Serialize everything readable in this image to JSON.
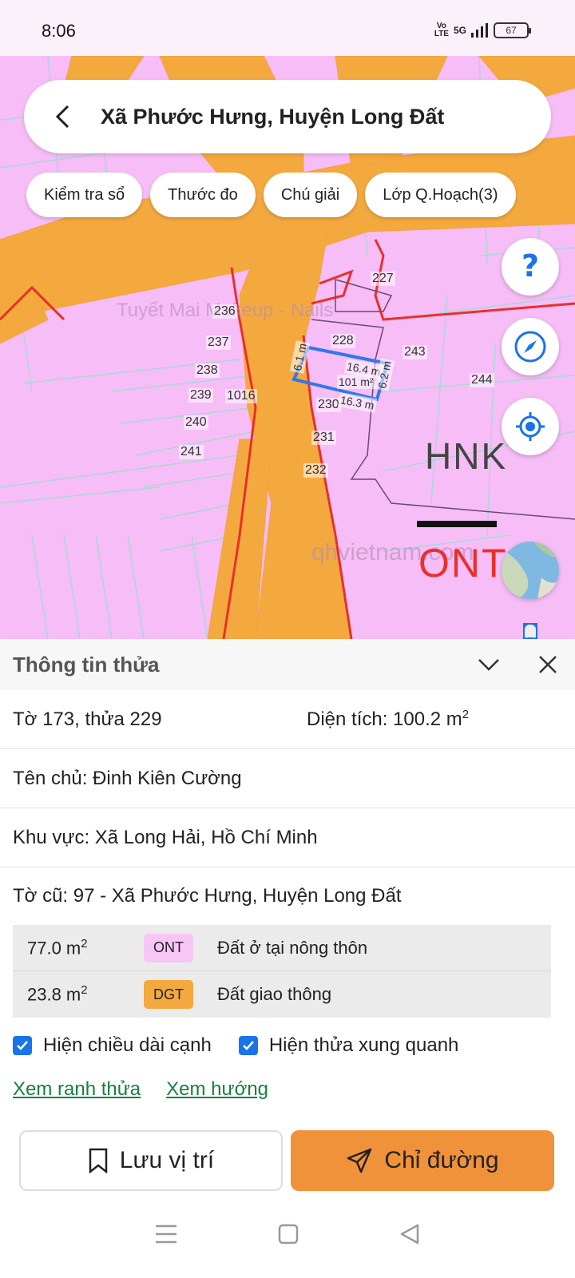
{
  "status_bar": {
    "time": "8:06",
    "network_top": "Vo",
    "network_bottom": "LTE",
    "network_type": "5G",
    "battery": "67"
  },
  "search": {
    "title": "Xã Phước Hưng, Huyện Long Đất"
  },
  "chips": [
    "Kiểm tra sổ",
    "Thước đo",
    "Chú giải",
    "Lớp Q.Hoạch(3)"
  ],
  "map": {
    "parcels": [
      "227",
      "228",
      "236",
      "237",
      "238",
      "239",
      "240",
      "241",
      "243",
      "244",
      "230",
      "231",
      "232",
      "1016"
    ],
    "measurements": {
      "top": "16.4 m",
      "area": "101 m²",
      "bottom": "16.3 m",
      "left": "6.1 m",
      "right": "6.2 m"
    },
    "zone_labels": [
      "HNK",
      "ONT"
    ],
    "watermark": "Tuyết Mai Makeup - Nails",
    "watermark2": "qhvietnam.com",
    "colors": {
      "residential": "#f7bdf7",
      "road": "#f4a93f",
      "boundary": "#e8302a",
      "selection": "#2f79e8"
    }
  },
  "sheet": {
    "title": "Thông tin thửa",
    "parcel": "Tờ 173, thửa 229",
    "area_label": "Diện tích: 100.2 m",
    "area_sup": "2",
    "owner": "Tên chủ: Đinh Kiên Cường",
    "region": "Khu vực: Xã Long Hải, Hồ Chí Minh",
    "old_sheet": "Tờ cũ: 97 - Xã Phước Hưng, Huyện Long Đất",
    "land_types": [
      {
        "area": "77.0 m",
        "sup": "2",
        "code": "ONT",
        "name": "Đất ở tại nông thôn",
        "color": "#f7c6f7"
      },
      {
        "area": "23.8 m",
        "sup": "2",
        "code": "DGT",
        "name": "Đất giao thông",
        "color": "#f4a93f"
      }
    ],
    "checkboxes": [
      "Hiện chiều dài cạnh",
      "Hiện thửa xung quanh"
    ],
    "links": [
      "Xem ranh thửa",
      "Xem hướng"
    ],
    "buttons": {
      "save": "Lưu vị trí",
      "directions": "Chỉ đường"
    }
  }
}
